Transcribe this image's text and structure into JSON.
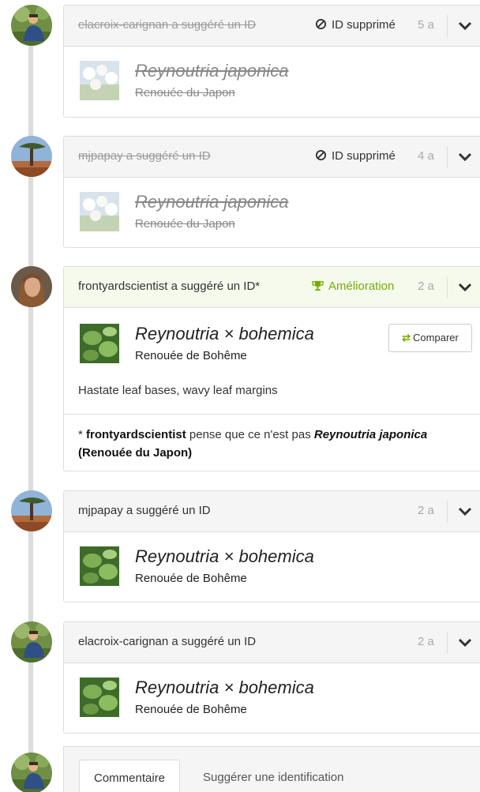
{
  "entries": [
    {
      "user": "elacroix-carignan",
      "action": "a suggéré un ID",
      "status": "ID supprimé",
      "age": "5 a",
      "taxon_name": "Reynoutria japonica",
      "taxon_common": "Renouée du Japon"
    },
    {
      "user": "mjpapay",
      "action": "a suggéré un ID",
      "status": "ID supprimé",
      "age": "4 a",
      "taxon_name": "Reynoutria japonica",
      "taxon_common": "Renouée du Japon"
    },
    {
      "user": "frontyardscientist",
      "action": "a suggéré un ID*",
      "status": "Amélioration",
      "age": "2 a",
      "taxon_name": "Reynoutria × bohemica",
      "taxon_common": "Renouée de Bohême",
      "compare_label": "Comparer",
      "reason": "Hastate leaf bases, wavy leaf margins",
      "disagree_prefix": "*",
      "disagree_user": "frontyardscientist",
      "disagree_text": "pense que ce n'est pas",
      "disagree_taxon": "Reynoutria japonica",
      "disagree_common": "(Renouée du Japon)"
    },
    {
      "user": "mjpapay",
      "action": "a suggéré un ID",
      "age": "2 a",
      "taxon_name": "Reynoutria × bohemica",
      "taxon_common": "Renouée de Bohême"
    },
    {
      "user": "elacroix-carignan",
      "action": "a suggéré un ID",
      "age": "2 a",
      "taxon_name": "Reynoutria × bohemica",
      "taxon_common": "Renouée de Bohême"
    }
  ],
  "tabs": {
    "comment": "Commentaire",
    "suggest": "Suggérer une identification"
  },
  "icons": {
    "withdrawn": "ban-icon",
    "improving": "trophy-icon",
    "expand": "chevron-down-icon",
    "compare": "exchange-icon"
  },
  "colors": {
    "improving": "#74ac00",
    "header_bg": "#f5f5f5",
    "improving_header_bg": "#f6faed",
    "muted": "#aaaaaa"
  }
}
